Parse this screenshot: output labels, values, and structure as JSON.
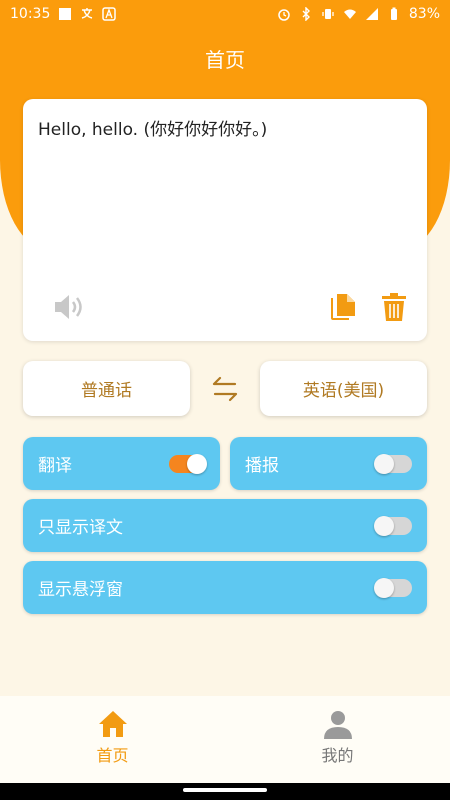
{
  "status_bar": {
    "time": "10:35",
    "battery": "83%"
  },
  "header": {
    "title": "首页"
  },
  "input_card": {
    "text": "Hello, hello. (你好你好你好。)"
  },
  "languages": {
    "source": "普通话",
    "target": "英语(美国)"
  },
  "toggles": {
    "translate": {
      "label": "翻译",
      "state": "on"
    },
    "broadcast": {
      "label": "播报",
      "state": "off"
    },
    "translation_only": {
      "label": "只显示译文",
      "state": "off"
    },
    "floating_window": {
      "label": "显示悬浮窗",
      "state": "off"
    }
  },
  "nav": {
    "home": "首页",
    "mine": "我的"
  },
  "colors": {
    "accent_orange": "#fb9c0c",
    "toggle_blue": "#5ec8f1",
    "icon_orange": "#f29b12"
  }
}
